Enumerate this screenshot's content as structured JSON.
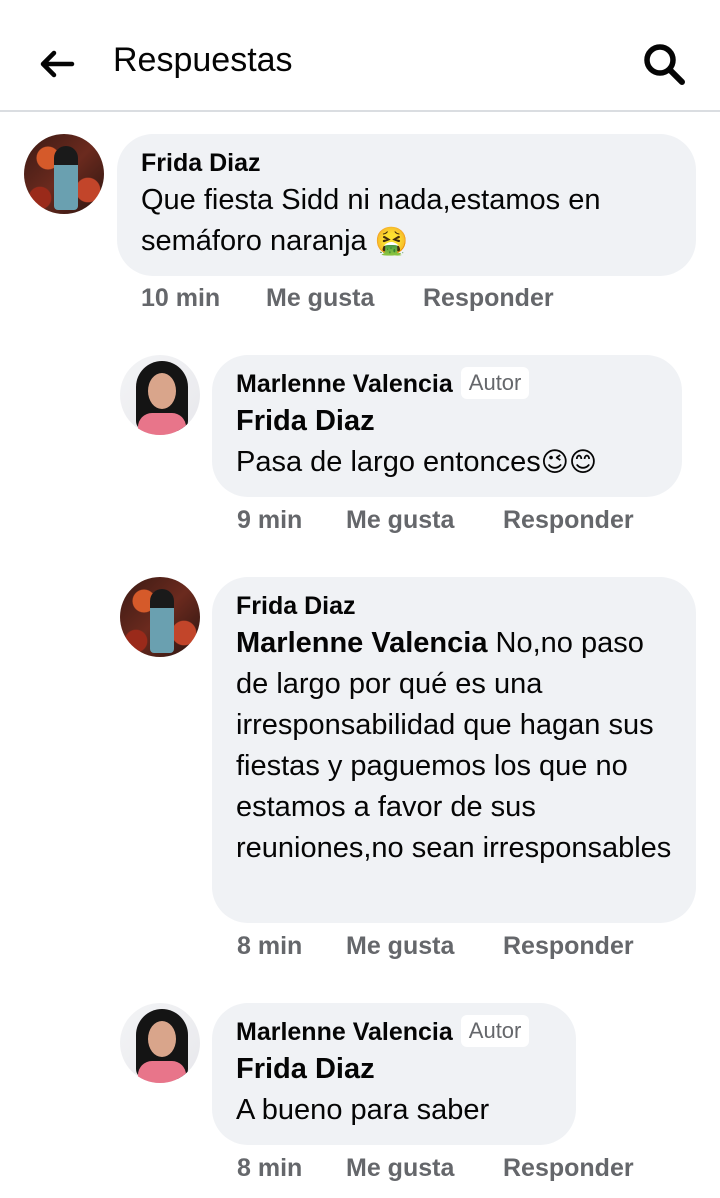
{
  "header": {
    "title": "Respuestas",
    "back_icon": "arrow-left-icon",
    "search_icon": "search-icon"
  },
  "comments": [
    {
      "author": "Frida Diaz",
      "text": "Que fiesta Sidd ni nada,estamos en semáforo naranja",
      "emoji": "🤮",
      "time": "10 min",
      "like": "Me gusta",
      "reply": "Responder"
    },
    {
      "author": "Marlenne Valencia",
      "badge": "Autor",
      "mention": "Frida Diaz",
      "text": "Pasa de largo entonces",
      "emoji": "😉😊",
      "time": "9 min",
      "like": "Me gusta",
      "reply": "Responder"
    },
    {
      "author": "Frida Diaz",
      "mention": "Marlenne Valencia",
      "text": "No,no paso de largo por qué es una irresponsabilidad que hagan sus fiestas y paguemos los que no estamos a favor de sus reuniones,no sean irresponsables",
      "time": "8 min",
      "like": "Me gusta",
      "reply": "Responder"
    },
    {
      "author": "Marlenne Valencia",
      "badge": "Autor",
      "mention": "Frida Diaz",
      "text": "A bueno para saber",
      "time": "8 min",
      "like": "Me gusta",
      "reply": "Responder"
    }
  ]
}
